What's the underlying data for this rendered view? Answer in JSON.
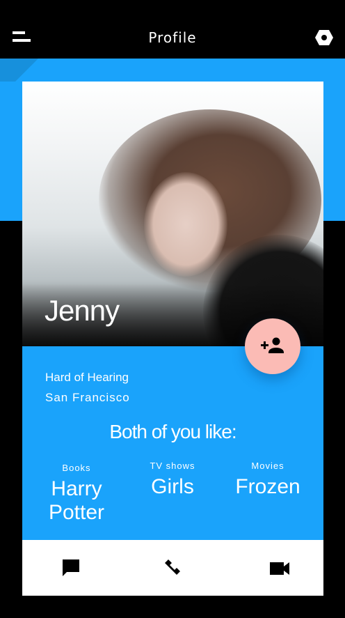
{
  "header": {
    "title": "Profile",
    "menu_icon": "menu-icon",
    "settings_icon": "hexagon-settings-icon"
  },
  "profile": {
    "name": "Jenny",
    "line1": "Hard of Hearing",
    "line2": "San Francisco"
  },
  "likes": {
    "heading": "Both of you like:",
    "items": [
      {
        "category": "Books",
        "value": "Harry Potter"
      },
      {
        "category": "TV shows",
        "value": "Girls"
      },
      {
        "category": "Movies",
        "value": "Frozen"
      }
    ]
  },
  "actions": {
    "fab_icon": "add-friend-icon",
    "items": [
      "message-icon",
      "phone-icon",
      "video-call-icon"
    ]
  },
  "colors": {
    "accent": "#1aa3fb",
    "fab": "#fbbbb5"
  }
}
